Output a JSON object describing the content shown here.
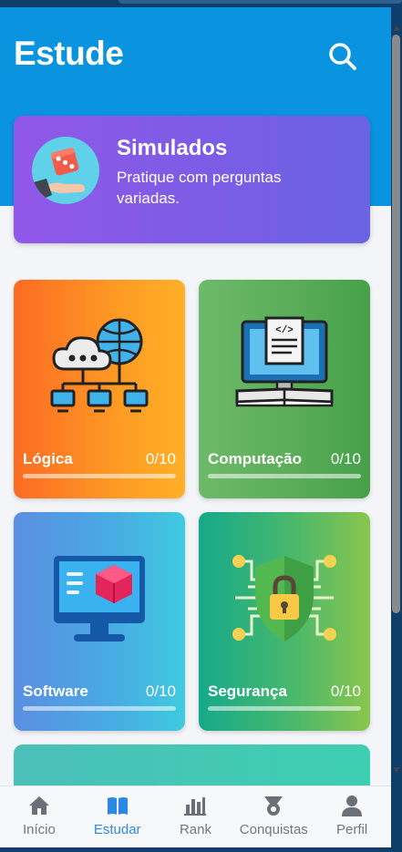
{
  "header": {
    "title": "Estude",
    "search_icon": "search-icon"
  },
  "simulados": {
    "title": "Simulados",
    "subtitle": "Pratique com perguntas variadas.",
    "icon": "dice-hand-icon"
  },
  "categories": [
    {
      "name": "Lógica",
      "count": "0/10",
      "progress": 0,
      "icon": "cloud-network-icon"
    },
    {
      "name": "Computação",
      "count": "0/10",
      "progress": 0,
      "icon": "computer-code-book-icon"
    },
    {
      "name": "Software",
      "count": "0/10",
      "progress": 0,
      "icon": "monitor-cube-icon"
    },
    {
      "name": "Segurança",
      "count": "0/10",
      "progress": 0,
      "icon": "shield-lock-icon"
    }
  ],
  "nav": [
    {
      "label": "Início",
      "icon": "home-icon",
      "active": false
    },
    {
      "label": "Estudar",
      "icon": "book-icon",
      "active": true
    },
    {
      "label": "Rank",
      "icon": "bar-chart-icon",
      "active": false
    },
    {
      "label": "Conquistas",
      "icon": "medal-icon",
      "active": false
    },
    {
      "label": "Perfil",
      "icon": "user-icon",
      "active": false
    }
  ],
  "colors": {
    "header": "#0a94e0",
    "nav_active": "#2b89e6",
    "nav_inactive": "#707780"
  }
}
